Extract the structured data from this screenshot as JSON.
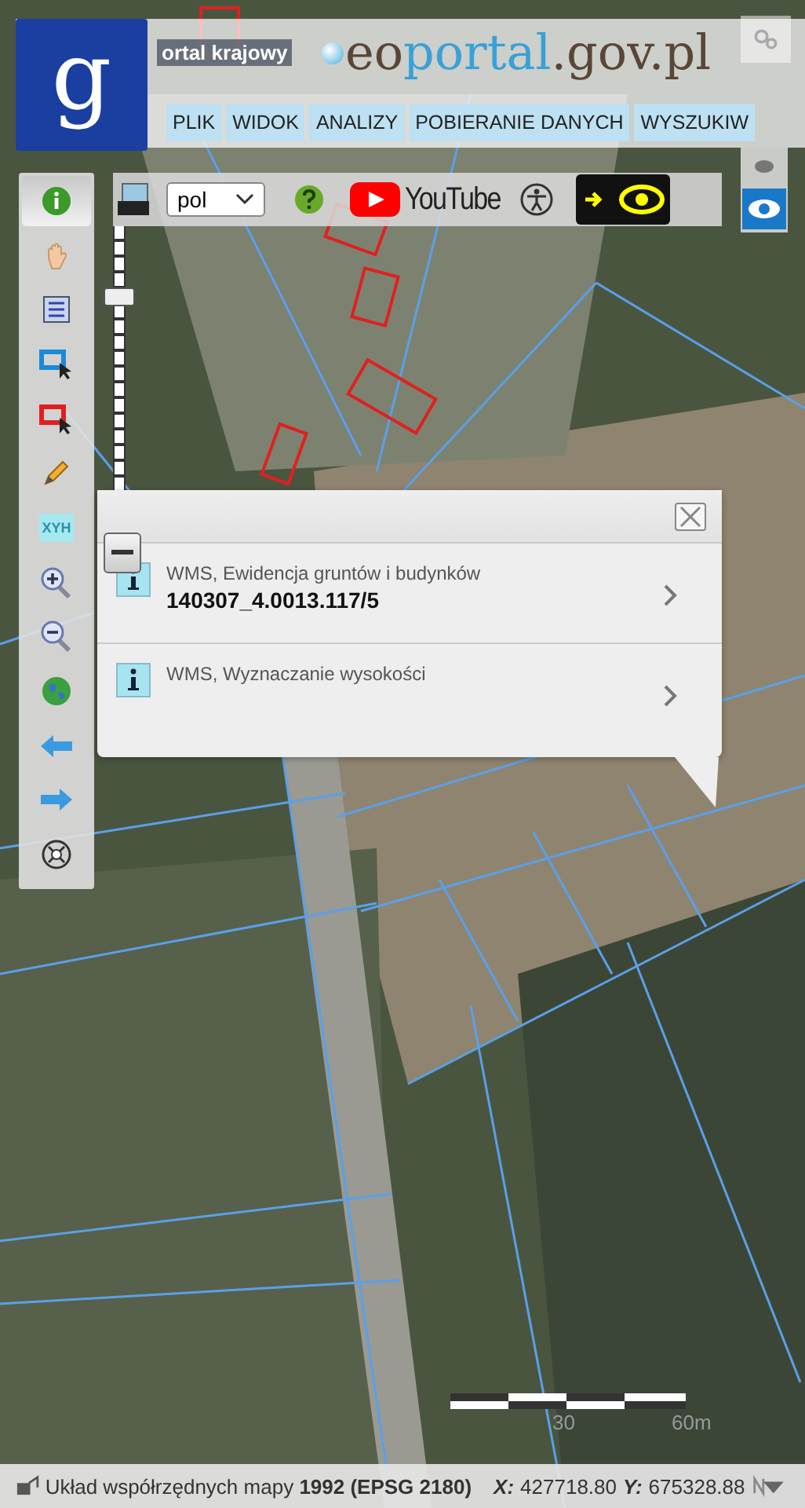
{
  "header": {
    "portal_title": "ortal krajowy",
    "logo_letter": "g",
    "site_logo": [
      "eo",
      "portal",
      ".gov.pl"
    ]
  },
  "menu": [
    {
      "label": "PLIK"
    },
    {
      "label": "WIDOK"
    },
    {
      "label": "ANALIZY"
    },
    {
      "label": "POBIERANIE DANYCH"
    },
    {
      "label": "WYSZUKIW"
    }
  ],
  "toolbar": {
    "language": "pol",
    "youtube": "YouTube"
  },
  "view_buttons": [
    {
      "kind": "eye-small",
      "selected": false
    },
    {
      "kind": "eye",
      "selected": true
    }
  ],
  "tools": [
    {
      "kind": "info",
      "selected": true
    },
    {
      "kind": "pan",
      "selected": false
    },
    {
      "kind": "legend",
      "selected": false
    },
    {
      "kind": "select-blue",
      "selected": false
    },
    {
      "kind": "select-red",
      "selected": false
    },
    {
      "kind": "pencil",
      "selected": false
    },
    {
      "kind": "xyh",
      "label": "XYH",
      "selected": false
    },
    {
      "kind": "zoom-in",
      "selected": false
    },
    {
      "kind": "zoom-out",
      "selected": false
    },
    {
      "kind": "globe",
      "selected": false
    },
    {
      "kind": "back",
      "selected": false
    },
    {
      "kind": "forward",
      "selected": false
    },
    {
      "kind": "extent",
      "selected": false
    }
  ],
  "zoom_slider": {
    "level": 0.8
  },
  "popup": {
    "items": [
      {
        "layer": "WMS, Ewidencja gruntów i budynków",
        "value": "140307_4.0013.117/5"
      },
      {
        "layer": "WMS, Wyznaczanie wysokości"
      }
    ]
  },
  "scale_bar": {
    "labels": [
      "30",
      "60m"
    ]
  },
  "status_bar": {
    "crs": "Układ współrzędnych mapy **1992 (EPSG 2180)**",
    "coords": [
      {
        "label": "X:",
        "value": "427718.80"
      },
      {
        "label": "Y:",
        "value": "675328.88"
      }
    ]
  }
}
